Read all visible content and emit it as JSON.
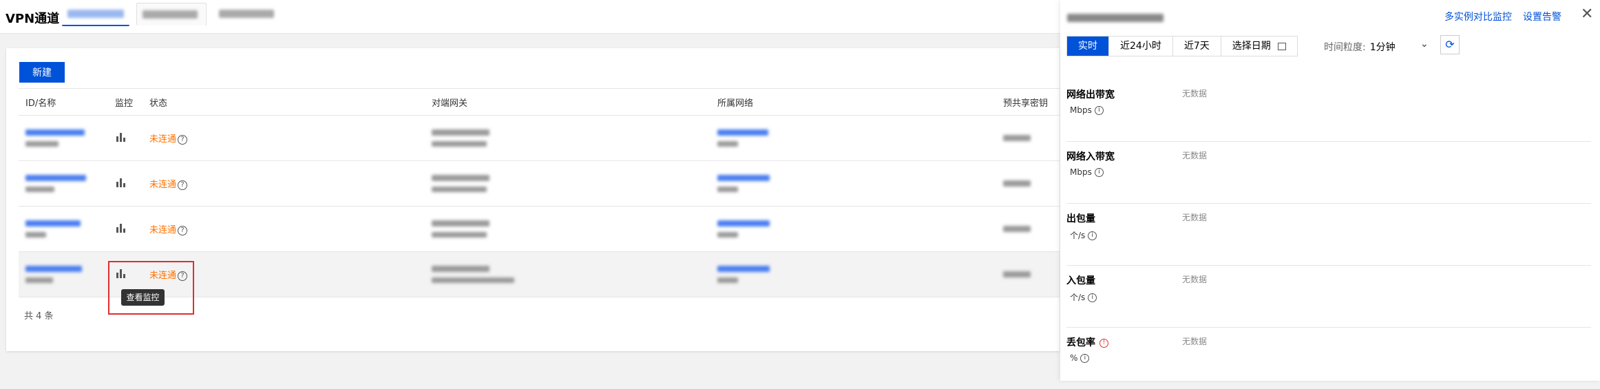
{
  "header": {
    "title": "VPN通道"
  },
  "toolbar": {
    "new_label": "新建"
  },
  "table": {
    "columns": [
      "ID/名称",
      "监控",
      "状态",
      "对端网关",
      "所属网络",
      "预共享密钥"
    ],
    "rows": [
      {
        "status": "未连通"
      },
      {
        "status": "未连通"
      },
      {
        "status": "未连通"
      },
      {
        "status": "未连通"
      }
    ],
    "total": "共 4 条",
    "tooltip": "查看监控"
  },
  "drawer": {
    "links": {
      "compare": "多实例对比监控",
      "alarm": "设置告警"
    },
    "close": "✕",
    "ranges": [
      "实时",
      "近24小时",
      "近7天",
      "选择日期"
    ],
    "granularity_label": "时间粒度:",
    "granularity_value": "1分钟",
    "refresh_icon": "⟳",
    "metrics": [
      {
        "name": "网络出带宽",
        "unit": "Mbps",
        "value": "无数据"
      },
      {
        "name": "网络入带宽",
        "unit": "Mbps",
        "value": "无数据"
      },
      {
        "name": "出包量",
        "unit": "个/s",
        "value": "无数据"
      },
      {
        "name": "入包量",
        "unit": "个/s",
        "value": "无数据"
      },
      {
        "name": "丢包率",
        "unit": "%",
        "value": "无数据"
      }
    ]
  },
  "colors": {
    "primary": "#0052d9",
    "warning": "#ff7200",
    "danger": "#e02d2d"
  }
}
